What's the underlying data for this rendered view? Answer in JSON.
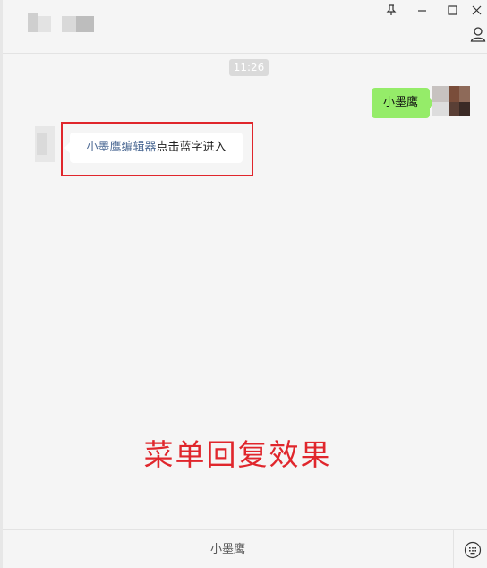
{
  "window": {
    "controls": {
      "pin": "pin-icon",
      "minimize": "minimize-icon",
      "maximize": "maximize-icon",
      "close": "close-icon"
    },
    "contact_icon": "person-icon"
  },
  "chat": {
    "timestamp": "11:26",
    "outgoing_message": "小墨鹰",
    "incoming_message": {
      "link": "小墨鹰编辑器",
      "text": "点击蓝字进入"
    },
    "caption": "菜单回复效果",
    "colors": {
      "outgoing_bubble": "#95ec69",
      "incoming_link": "#4e6b95",
      "highlight": "#e0262c"
    }
  },
  "bottom_menu": {
    "item_label": "小墨鹰",
    "keyboard_icon": "keyboard-icon"
  }
}
